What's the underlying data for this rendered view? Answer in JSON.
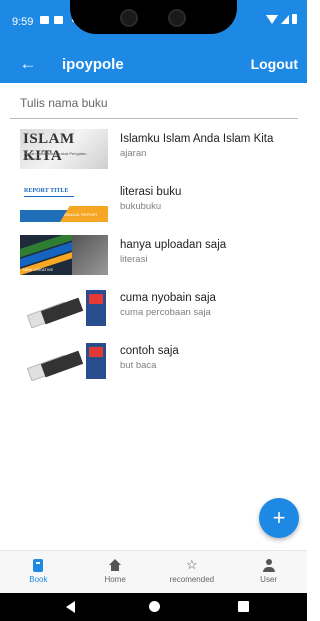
{
  "status_bar": {
    "time": "9:59"
  },
  "app_bar": {
    "title": "ipoypole",
    "logout_label": "Logout",
    "back_icon": "arrow-left-icon"
  },
  "search": {
    "placeholder": "Tulis nama buku",
    "value": ""
  },
  "books": [
    {
      "title": "Islamku Islam Anda Islam Kita",
      "subtitle": "ajaran",
      "cover_text": "ISLAM KITA",
      "cover_subtext": "Ajaran untuk Masyarakat Pengatau Indonesia"
    },
    {
      "title": "literasi buku",
      "subtitle": "bukubuku",
      "cover_text": "REPORT TITLE",
      "cover_subtext": "ANNUAL REPORT"
    },
    {
      "title": "hanya uploadan saja",
      "subtitle": "literasi",
      "cover_text": "NEW CREATIVE"
    },
    {
      "title": "cuma nyobain saja",
      "subtitle": "cuma percobaan saja"
    },
    {
      "title": "contoh saja",
      "subtitle": "but baca"
    }
  ],
  "fab": {
    "icon": "plus-icon",
    "symbol": "+"
  },
  "bottom_nav": [
    {
      "label": "Book",
      "icon": "book-icon",
      "active": true
    },
    {
      "label": "Home",
      "icon": "home-icon",
      "active": false
    },
    {
      "label": "recomended",
      "icon": "star-icon",
      "active": false,
      "glyph": "☆"
    },
    {
      "label": "User",
      "icon": "user-icon",
      "active": false
    }
  ],
  "colors": {
    "primary": "#1e88e5",
    "text_primary": "#222222",
    "text_secondary": "#808080"
  }
}
